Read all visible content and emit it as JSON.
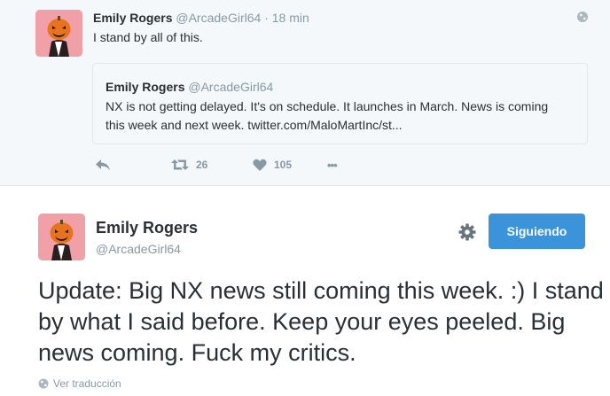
{
  "top_tweet": {
    "author_name": "Emily Rogers",
    "author_handle": "@ArcadeGirl64",
    "separator": "·",
    "time": "18 min",
    "text": "I stand by all of this.",
    "quote": {
      "author_name": "Emily Rogers",
      "author_handle": "@ArcadeGirl64",
      "text": "NX is not getting delayed. It's on schedule. It launches in March. News is coming this week and next week. twitter.com/MaloMartInc/st..."
    },
    "actions": {
      "retweet_count": "26",
      "like_count": "105",
      "more_label": "•••"
    }
  },
  "main_tweet": {
    "author_name": "Emily Rogers",
    "author_handle": "@ArcadeGirl64",
    "follow_label": "Siguiendo",
    "text": "Update:  Big NX news still coming this week. :) I stand by what I said before. Keep your eyes peeled. Big news coming. Fuck my critics.",
    "translate_label": "Ver traducción"
  },
  "colors": {
    "accent": "#3b94d9",
    "muted": "#8899a6",
    "avatar_bg": "#f2a0a8"
  },
  "icons": [
    "globe-icon",
    "reply-icon",
    "retweet-icon",
    "heart-icon",
    "more-icon",
    "gear-icon",
    "translate-globe-icon",
    "pumpkin-avatar"
  ]
}
